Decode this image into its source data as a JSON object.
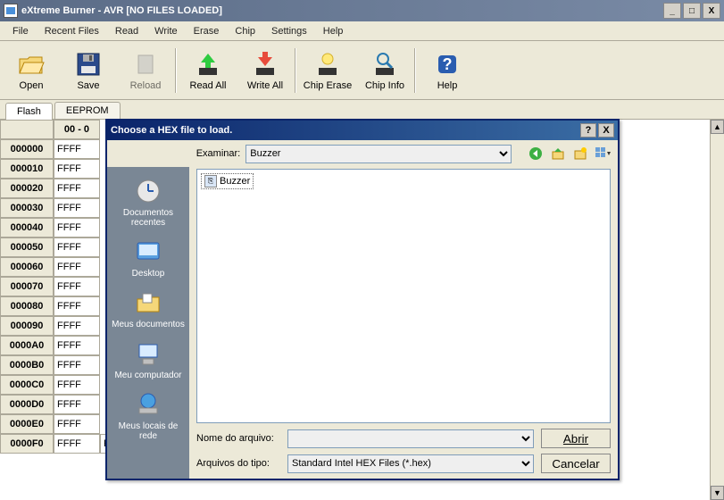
{
  "window": {
    "title": "eXtreme Burner - AVR [NO FILES LOADED]",
    "min_label": "_",
    "max_label": "□",
    "close_label": "X"
  },
  "menubar": [
    "File",
    "Recent Files",
    "Read",
    "Write",
    "Erase",
    "Chip",
    "Settings",
    "Help"
  ],
  "toolbar": {
    "open": "Open",
    "save": "Save",
    "reload": "Reload",
    "read_all": "Read All",
    "write_all": "Write All",
    "chip_erase": "Chip Erase",
    "chip_info": "Chip Info",
    "help": "Help"
  },
  "tabs": {
    "flash": "Flash",
    "eeprom": "EEPROM"
  },
  "grid": {
    "colhdr0": "00 - 0",
    "rows": [
      "000000",
      "000010",
      "000020",
      "000030",
      "000040",
      "000050",
      "000060",
      "000070",
      "000080",
      "000090",
      "0000A0",
      "0000B0",
      "0000C0",
      "0000D0",
      "0000E0",
      "0000F0"
    ],
    "cell_value": "FFFF"
  },
  "dialog": {
    "title": "Choose a HEX file to load.",
    "help_label": "?",
    "close_label": "X",
    "lookin_label": "Examinar:",
    "lookin_value": "Buzzer",
    "places": {
      "recent": "Documentos recentes",
      "desktop": "Desktop",
      "mydocs": "Meus documentos",
      "mycomputer": "Meu computador",
      "network": "Meus locais de rede"
    },
    "file_item": "Buzzer",
    "filename_label": "Nome do arquivo:",
    "filename_value": "",
    "filetype_label": "Arquivos do tipo:",
    "filetype_value": "Standard Intel HEX Files (*.hex)",
    "open_btn": "Abrir",
    "cancel_btn": "Cancelar"
  }
}
